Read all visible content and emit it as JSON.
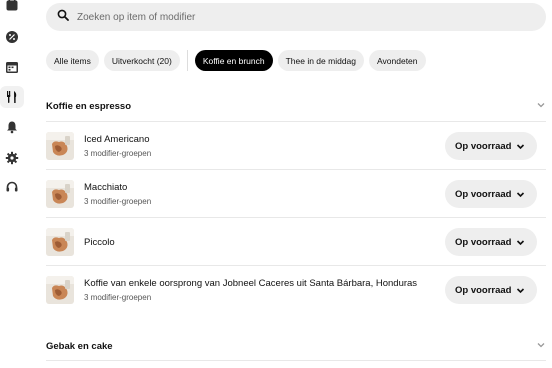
{
  "sidebar": {
    "items": [
      {
        "icon": "calendar-icon"
      },
      {
        "icon": "discount-icon"
      },
      {
        "icon": "calendar-grid-icon"
      },
      {
        "icon": "utensils-icon",
        "active": true
      },
      {
        "icon": "bell-icon"
      },
      {
        "icon": "gear-icon"
      },
      {
        "icon": "support-icon"
      }
    ]
  },
  "search": {
    "placeholder": "Zoeken op item of modifier"
  },
  "filters": {
    "status_chips": [
      "Alle items",
      "Uitverkocht (20)"
    ],
    "menu_chips": [
      "Koffie en brunch",
      "Thee in de middag",
      "Avondeten"
    ],
    "active": "Koffie en brunch"
  },
  "sections": [
    {
      "title": "Koffie en espresso",
      "items": [
        {
          "name": "Iced Americano",
          "sub": "3 modifier-groepen",
          "status": "Op voorraad"
        },
        {
          "name": "Macchiato",
          "sub": "3 modifier-groepen",
          "status": "Op voorraad"
        },
        {
          "name": "Piccolo",
          "sub": "",
          "status": "Op voorraad"
        },
        {
          "name": "Koffie van enkele oorsprong van Jobneel Caceres uit Santa Bárbara, Honduras",
          "sub": "3 modifier-groepen",
          "status": "Op voorraad"
        }
      ]
    },
    {
      "title": "Gebak en cake"
    }
  ]
}
